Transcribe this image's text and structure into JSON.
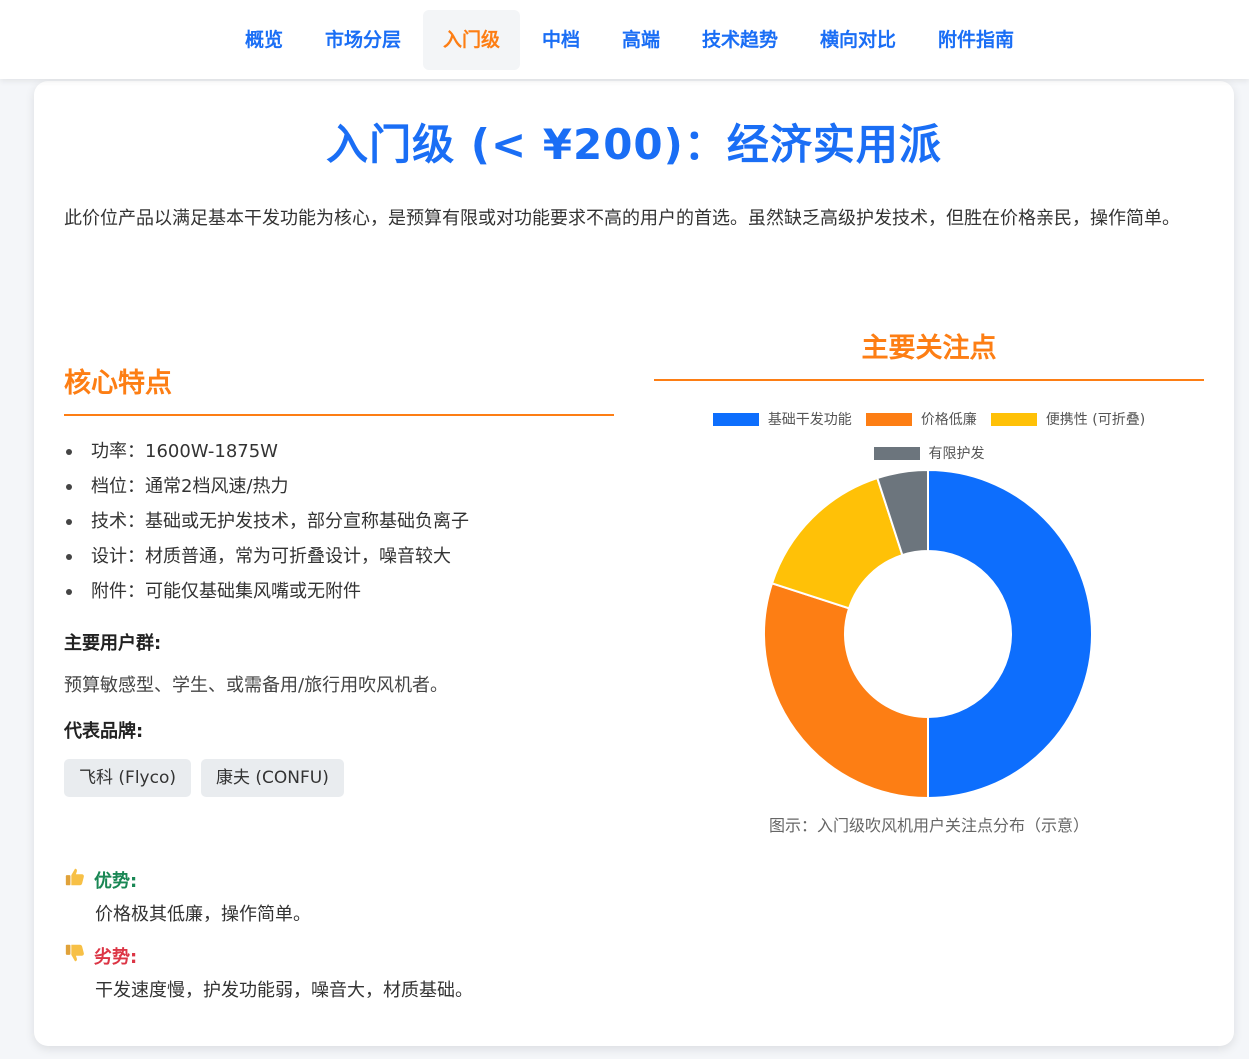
{
  "nav": {
    "items": [
      {
        "label": "概览",
        "active": false
      },
      {
        "label": "市场分层",
        "active": false
      },
      {
        "label": "入门级",
        "active": true
      },
      {
        "label": "中档",
        "active": false
      },
      {
        "label": "高端",
        "active": false
      },
      {
        "label": "技术趋势",
        "active": false
      },
      {
        "label": "横向对比",
        "active": false
      },
      {
        "label": "附件指南",
        "active": false
      }
    ]
  },
  "page": {
    "title": "入门级 (< ¥200)：经济实用派",
    "intro": "此价位产品以满足基本干发功能为核心，是预算有限或对功能要求不高的用户的首选。虽然缺乏高级护发技术，但胜在价格亲民，操作简单。"
  },
  "features": {
    "title": "核心特点",
    "items": [
      "功率：1600W-1875W",
      "档位：通常2档风速/热力",
      "技术：基础或无护发技术，部分宣称基础负离子",
      "设计：材质普通，常为可折叠设计，噪音较大",
      "附件：可能仅基础集风嘴或无附件"
    ],
    "users_heading": "主要用户群:",
    "users_text": "预算敏感型、学生、或需备用/旅行用吹风机者。",
    "brands_heading": "代表品牌:",
    "brands": [
      "飞科 (Flyco)",
      "康夫 (CONFU)"
    ]
  },
  "pros_cons": {
    "pro_icon": "thumbs-up-icon",
    "pro_label": "优势:",
    "pro_text": "价格极其低廉，操作简单。",
    "con_icon": "thumbs-down-icon",
    "con_label": "劣势:",
    "con_text": "干发速度慢，护发功能弱，噪音大，材质基础。"
  },
  "chart_data": {
    "type": "pie",
    "title": "主要关注点",
    "categories": [
      "基础干发功能",
      "价格低廉",
      "便携性 (可折叠)",
      "有限护发"
    ],
    "values": [
      50,
      30,
      15,
      5
    ],
    "colors": [
      "#0d6efd",
      "#fd7e14",
      "#ffc107",
      "#6c757d"
    ],
    "donut": true,
    "legend": "top",
    "caption": "图示：入门级吹风机用户关注点分布（示意）"
  }
}
